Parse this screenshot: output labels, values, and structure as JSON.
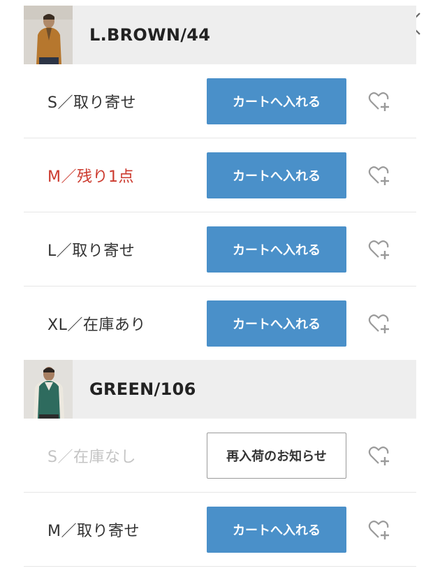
{
  "groups": [
    {
      "title": "L.BROWN/44",
      "rows": [
        {
          "size": "S／取り寄せ",
          "status": "normal",
          "button": "カートへ入れる"
        },
        {
          "size": "M／残り1点",
          "status": "low",
          "button": "カートへ入れる"
        },
        {
          "size": "L／取り寄せ",
          "status": "normal",
          "button": "カートへ入れる"
        },
        {
          "size": "XL／在庫あり",
          "status": "normal",
          "button": "カートへ入れる"
        }
      ]
    },
    {
      "title": "GREEN/106",
      "rows": [
        {
          "size": "S／在庫なし",
          "status": "out",
          "button": "再入荷のお知らせ"
        },
        {
          "size": "M／取り寄せ",
          "status": "normal",
          "button": "カートへ入れる"
        }
      ]
    }
  ],
  "icons": {
    "close": "close-icon",
    "favorite": "heart-plus-icon"
  },
  "colors": {
    "cart_button": "#4a90c9",
    "low_stock_text": "#cc3a2e",
    "out_of_stock_text": "#c4c4c4",
    "group_header_bg": "#eeeeee"
  }
}
